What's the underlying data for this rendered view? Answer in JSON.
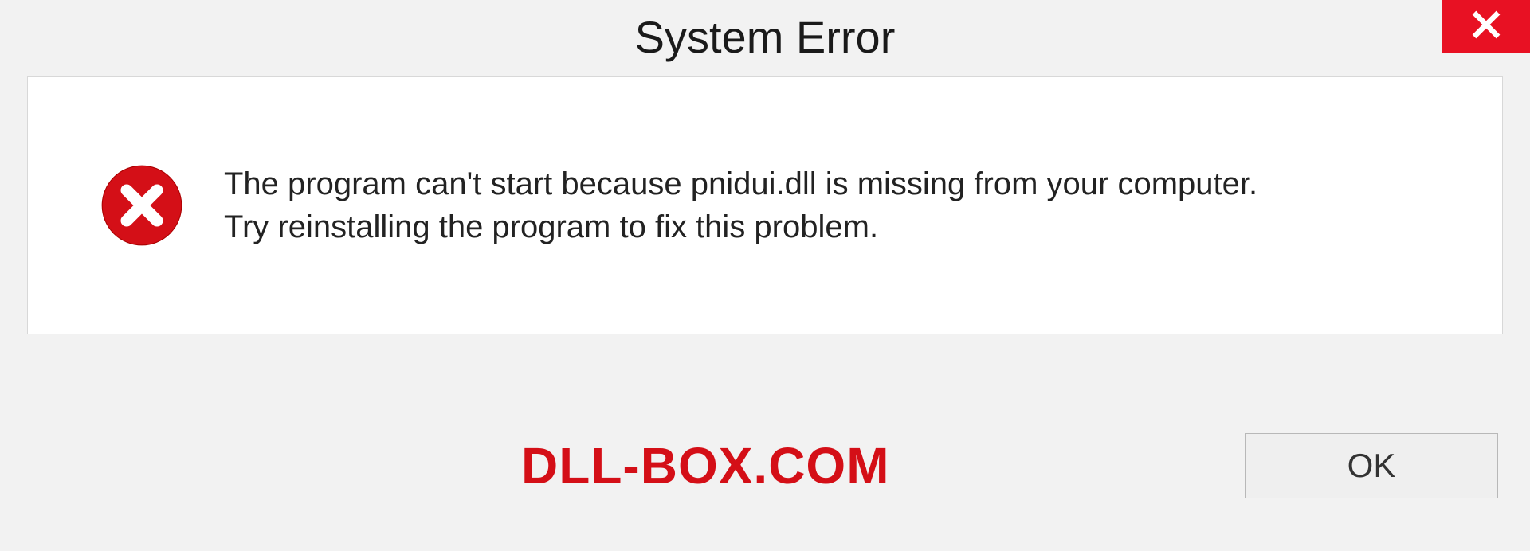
{
  "dialog": {
    "title": "System Error",
    "message_line1": "The program can't start because pnidui.dll is missing from your computer.",
    "message_line2": "Try reinstalling the program to fix this problem.",
    "ok_label": "OK"
  },
  "watermark": {
    "text": "DLL-BOX.COM"
  },
  "colors": {
    "close_bg": "#e81123",
    "error_red": "#d40f17"
  },
  "icons": {
    "close": "close-icon",
    "error": "error-circle-x-icon"
  }
}
